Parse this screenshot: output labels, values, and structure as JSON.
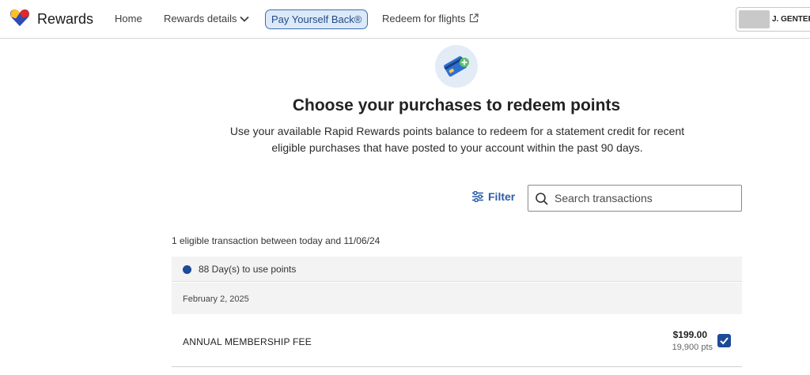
{
  "header": {
    "brand": "Rewards",
    "nav": {
      "home": "Home",
      "rewards_details": "Rewards details",
      "pay_yourself_back": "Pay Yourself Back®",
      "redeem_flights": "Redeem for flights"
    },
    "account_name": "J. GENTER"
  },
  "hero": {
    "title": "Choose your purchases to redeem points",
    "description": "Use your available Rapid Rewards points balance to redeem for a statement credit for recent eligible purchases that have posted to your account within the past 90 days."
  },
  "filter": {
    "label": "Filter"
  },
  "search": {
    "placeholder": "Search transactions",
    "value": ""
  },
  "transactions": {
    "summary": "1 eligible transaction between today and 11/06/24",
    "days_to_use": "88 Day(s) to use points",
    "groups": [
      {
        "date": "February 2, 2025",
        "items": [
          {
            "name": "ANNUAL MEMBERSHIP FEE",
            "amount": "$199.00",
            "points": "19,900 pts",
            "selected": true
          }
        ]
      }
    ]
  },
  "colors": {
    "accent_blue": "#1d4a99",
    "link_blue": "#2b5ea6",
    "pill_bg": "#dbe9f8",
    "row_gray": "#f3f3f3"
  },
  "icons": [
    "southwest-heart-logo",
    "chevron-down-icon",
    "external-link-icon",
    "card-plus-icon",
    "filter-sliders-icon",
    "search-icon",
    "checkbox-checked-icon"
  ]
}
